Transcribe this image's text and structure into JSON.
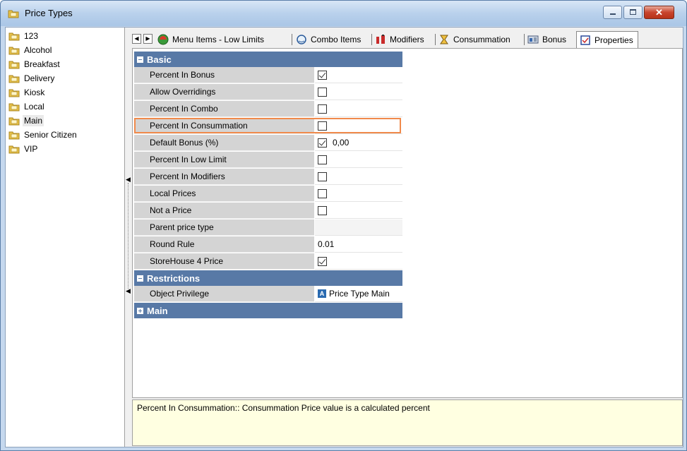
{
  "window": {
    "title": "Price Types",
    "minimize_label": "",
    "maximize_label": "",
    "close_label": "✕"
  },
  "tree": {
    "items": [
      {
        "label": "123"
      },
      {
        "label": "Alcohol"
      },
      {
        "label": "Breakfast"
      },
      {
        "label": "Delivery"
      },
      {
        "label": "Kiosk"
      },
      {
        "label": "Local"
      },
      {
        "label": "Main",
        "selected": true
      },
      {
        "label": "Senior Citizen"
      },
      {
        "label": "VIP"
      }
    ]
  },
  "tabs": {
    "items": [
      {
        "label": "Menu Items - Low Limits",
        "icon": "menu-items-icon"
      },
      {
        "label": "Combo Items",
        "icon": "combo-icon"
      },
      {
        "label": "Modifiers",
        "icon": "modifiers-icon"
      },
      {
        "label": "Consummation",
        "icon": "consummation-icon"
      },
      {
        "label": "Bonus",
        "icon": "bonus-icon"
      },
      {
        "label": "Properties",
        "icon": "properties-icon",
        "active": true
      }
    ]
  },
  "grid": {
    "basic": {
      "label": "Basic",
      "rows": [
        {
          "name": "Percent In Bonus",
          "checked": true,
          "value": ""
        },
        {
          "name": "Allow Overridings",
          "checked": false,
          "value": ""
        },
        {
          "name": "Percent In Combo",
          "checked": false,
          "value": ""
        },
        {
          "name": "Percent In Consummation",
          "checked": false,
          "value": ""
        },
        {
          "name": "Default Bonus (%)",
          "checked": true,
          "value": "0,00"
        },
        {
          "name": "Percent In Low Limit",
          "checked": false,
          "value": ""
        },
        {
          "name": "Percent In Modifiers",
          "checked": false,
          "value": ""
        },
        {
          "name": "Local Prices",
          "checked": false,
          "value": ""
        },
        {
          "name": "Not a Price",
          "checked": false,
          "value": ""
        },
        {
          "name": "Parent price type",
          "value": ""
        },
        {
          "name": "Round Rule",
          "value": "0.01"
        },
        {
          "name": "StoreHouse 4 Price",
          "checked": true,
          "value": ""
        }
      ]
    },
    "restrictions": {
      "label": "Restrictions",
      "rows": [
        {
          "name": "Object Privilege",
          "value": "Price Type Main",
          "flag": "A"
        }
      ]
    },
    "main": {
      "label": "Main"
    }
  },
  "description": "Percent In Consummation:: Consummation Price value is a calculated percent",
  "colors": {
    "category": "#5879a6",
    "highlight": "#f08a4b",
    "description_bg": "#ffffe1"
  }
}
